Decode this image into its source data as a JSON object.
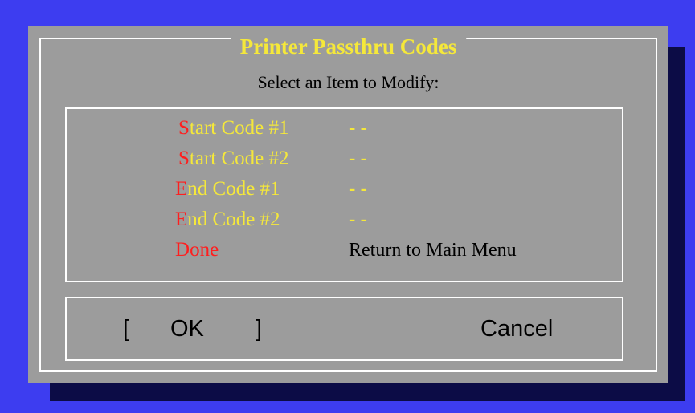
{
  "dialog": {
    "title": "Printer Passthru Codes",
    "prompt": "Select an Item to Modify:"
  },
  "items": [
    {
      "hotkey": "S",
      "rest": "tart  Code #1",
      "value": "- -"
    },
    {
      "hotkey": "S",
      "rest": "tart  Code #2",
      "value": "- -"
    },
    {
      "hotkey": "E",
      "rest": "nd Code #1",
      "value": "- -"
    },
    {
      "hotkey": "E",
      "rest": "nd Code #2",
      "value": "- -"
    },
    {
      "hotkey": "D",
      "rest": "one",
      "value": "Return to Main Menu"
    }
  ],
  "buttons": {
    "ok": {
      "open_bracket": "[",
      "label": "OK",
      "close_bracket": "]"
    },
    "cancel": {
      "label": "Cancel"
    }
  },
  "colors": {
    "desktop": "#3d3df0",
    "dialog": "#9c9c9c",
    "title": "#f5e83a",
    "hotkey": "#ff1e1e",
    "shadow": "#0c0c46"
  }
}
